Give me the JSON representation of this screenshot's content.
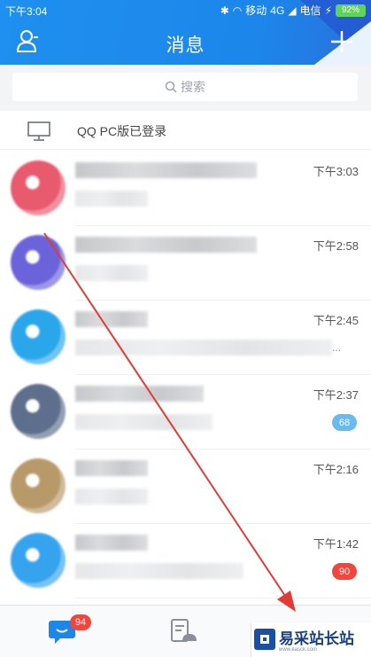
{
  "statusbar": {
    "time": "下午3:04",
    "carrier1": "移动",
    "network": "4G",
    "carrier2": "电信",
    "battery": "92%"
  },
  "header": {
    "title": "消息",
    "accent": "#1c86ea"
  },
  "search": {
    "placeholder": "搜索"
  },
  "pc_status": {
    "label": "QQ PC版已登录"
  },
  "chats": [
    {
      "time": "下午3:03",
      "badge": "",
      "avatar_color": "#e85a6e"
    },
    {
      "time": "下午2:58",
      "badge": "",
      "avatar_color": "#6b63d9"
    },
    {
      "time": "下午2:45",
      "badge": "",
      "avatar_color": "#2aa7ea",
      "ellipsis": "..."
    },
    {
      "time": "下午2:37",
      "badge": "68",
      "badge_color": "#6ab9ef",
      "avatar_color": "#5d6f8c"
    },
    {
      "time": "下午2:16",
      "badge": "",
      "avatar_color": "#b89a6a"
    },
    {
      "time": "下午1:42",
      "badge": "90",
      "badge_color": "#f2453d",
      "avatar_color": "#35a3ee"
    }
  ],
  "tabbar": {
    "messages_badge": "94"
  },
  "watermark": {
    "text": "易采站长站",
    "sub": "www.easck.com"
  },
  "icons": {
    "contacts": "contacts-icon",
    "add": "plus-icon",
    "search": "search-icon",
    "pc": "monitor-icon",
    "messages": "chat-bubble-icon",
    "feeds": "feed-icon"
  }
}
